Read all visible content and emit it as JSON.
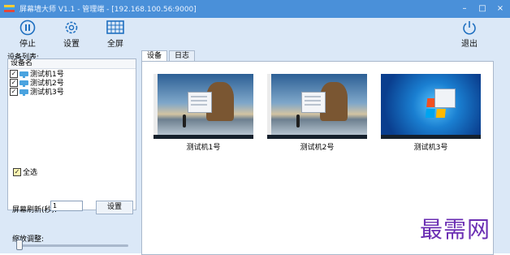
{
  "window": {
    "title": "屏幕墙大师 V1.1 - 管理端 - [192.168.100.56:9000]"
  },
  "toolbar": {
    "stop_label": "停止",
    "settings_label": "设置",
    "fullscreen_label": "全屏",
    "exit_label": "退出"
  },
  "device_list": {
    "title": "设备列表:",
    "column_header": "设备名",
    "items": [
      {
        "label": "测试机1号",
        "checked": true
      },
      {
        "label": "测试机2号",
        "checked": true
      },
      {
        "label": "测试机3号",
        "checked": true
      }
    ]
  },
  "select_all": {
    "label": "全选",
    "checked": true
  },
  "refresh": {
    "label": "屏幕刷新(秒):",
    "value": "1",
    "button_label": "设置"
  },
  "zoom": {
    "label": "缩放调整:"
  },
  "tabs": [
    {
      "label": "设备",
      "active": true
    },
    {
      "label": "日志",
      "active": false
    }
  ],
  "screens": [
    {
      "caption": "测试机1号",
      "os": "windows-10"
    },
    {
      "caption": "测试机2号",
      "os": "windows-10"
    },
    {
      "caption": "测试机3号",
      "os": "windows-7"
    }
  ],
  "watermark": "最需网"
}
